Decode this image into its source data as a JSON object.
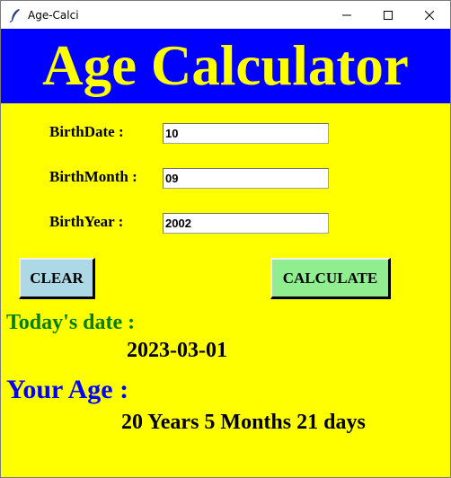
{
  "window": {
    "title": "Age-Calci",
    "icon": "feather-icon",
    "controls": [
      "minimize-icon",
      "maximize-icon",
      "close-icon"
    ]
  },
  "header": {
    "title": "Age Calculator",
    "background": "#0000ff",
    "color": "#ffff00"
  },
  "form": {
    "birth_date": {
      "label": "BirthDate :",
      "value": "10"
    },
    "birth_month": {
      "label": "BirthMonth :",
      "value": "09"
    },
    "birth_year": {
      "label": "BirthYear :",
      "value": "2002"
    }
  },
  "buttons": {
    "clear_label": "CLEAR",
    "calculate_label": "CALCULATE"
  },
  "result": {
    "todays_date_label": "Today's date :",
    "todays_date_value": "2023-03-01",
    "your_age_label": "Your Age :",
    "your_age_value": "20 Years 5 Months 21 days"
  },
  "colors": {
    "background": "#ffff00",
    "clear_button": "#add8e6",
    "calculate_button": "#90ee90",
    "todays_label": "#008000",
    "age_label": "#0000ff"
  }
}
